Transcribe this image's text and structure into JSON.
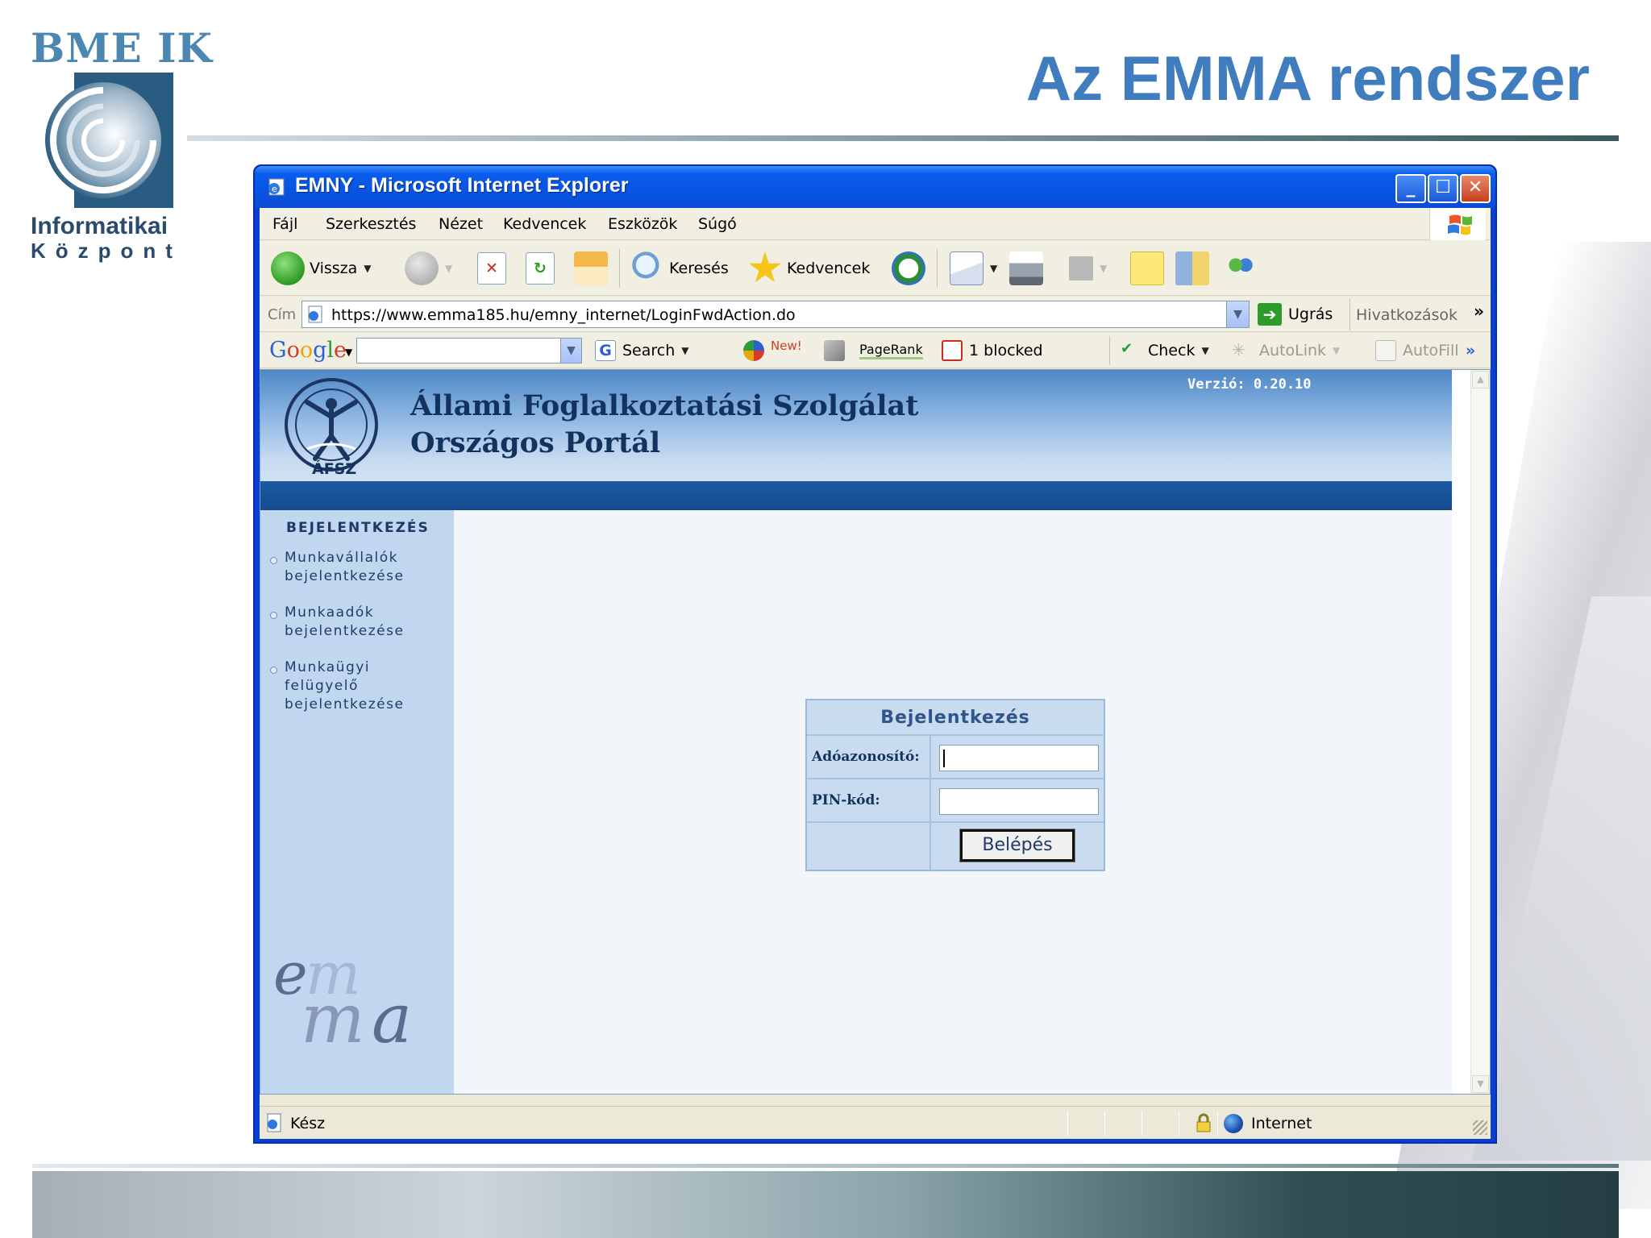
{
  "slide": {
    "title": "Az EMMA rendszer",
    "logo_top": "BME IK",
    "logo_bottom_line1": "Informatikai",
    "logo_bottom_line2": "Központ"
  },
  "window": {
    "title": "EMNY - Microsoft Internet Explorer",
    "controls": [
      "minimize-icon",
      "maximize-icon",
      "close-icon"
    ]
  },
  "menu": {
    "items": [
      "Fájl",
      "Szerkesztés",
      "Nézet",
      "Kedvencek",
      "Eszközök",
      "Súgó"
    ]
  },
  "toolbar": {
    "back_label": "Vissza",
    "search_label": "Keresés",
    "favorites_label": "Kedvencek"
  },
  "address": {
    "label": "Cím",
    "url": "https://www.emma185.hu/emny_internet/LoginFwdAction.do",
    "go_label": "Ugrás",
    "links_label": "Hivatkozások",
    "overflow": "»"
  },
  "google_bar": {
    "logo": [
      "G",
      "o",
      "o",
      "g",
      "l",
      "e"
    ],
    "search_label": "Search",
    "new_label": "New!",
    "pagerank_label": "PageRank",
    "blocked_label": "1 blocked",
    "check_label": "Check",
    "autolink_label": "AutoLink",
    "autofill_label": "AutoFill",
    "overflow": "»"
  },
  "site": {
    "title_line1": "Állami Foglalkoztatási Szolgálat",
    "title_line2": "Országos Portál",
    "version": "Verzió: 0.20.10",
    "logo_text": "ÁFSZ",
    "nav_heading": "BEJELENTKEZÉS",
    "nav_links": [
      {
        "line1": "Munkavállalók",
        "line2": "bejelentkezése",
        "line3": ""
      },
      {
        "line1": "Munkaadók",
        "line2": "bejelentkezése",
        "line3": ""
      },
      {
        "line1": "Munkaügyi",
        "line2": "felügyelő",
        "line3": "bejelentkezése"
      }
    ],
    "emma_logo": "emma"
  },
  "login": {
    "heading": "Bejelentkezés",
    "tax_id_label": "Adóazonosító:",
    "tax_id_value": "",
    "pin_label": "PIN-kód:",
    "pin_value": "",
    "submit_label": "Belépés"
  },
  "status": {
    "text": "Kész",
    "zone": "Internet"
  },
  "colors": {
    "title_blue": "#3f7dbf",
    "xp_titlebar": "#0a5ded",
    "site_header": "#4e88c7",
    "nav_bg": "#c0d7ef"
  }
}
